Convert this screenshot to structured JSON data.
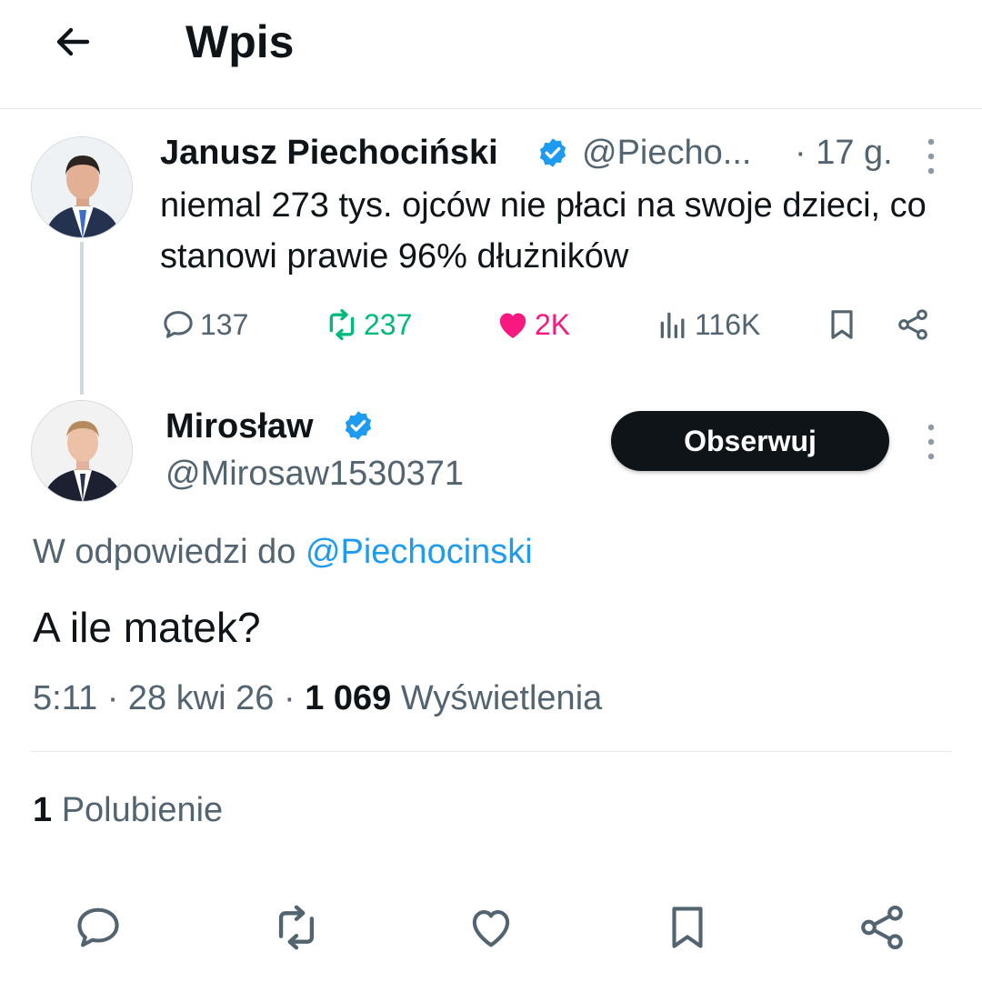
{
  "header": {
    "title": "Wpis",
    "back_icon": "arrow-left-icon"
  },
  "parent_post": {
    "author_name": "Janusz Piechociński",
    "handle": "@Piecho...",
    "time": "· 17 g.",
    "text": "niemal 273 tys. ojców nie płaci na swoje dzieci, co stanowi prawie 96% dłużników",
    "stats": {
      "replies": "137",
      "reposts": "237",
      "likes": "2K",
      "views": "116K"
    }
  },
  "reply_post": {
    "author_name": "Mirosław",
    "handle": "@Mirosaw1530371",
    "follow_label": "Obserwuj",
    "reply_prefix": "W odpowiedzi do ",
    "reply_mention": "@Piechocinski",
    "text": "A ile matek?",
    "time": "5:11 · 28 kwi 26 · ",
    "views_count": "1 069",
    "views_label": " Wyświetlenia"
  },
  "engagement": {
    "likes_count": "1",
    "likes_label": " Polubienie"
  },
  "colors": {
    "text": "#0f1419",
    "secondary": "#536471",
    "verified": "#1d9bf0",
    "repost": "#00ba7c",
    "like": "#f91880",
    "follow_bg": "#0f1419",
    "divider": "#e6e9eb"
  }
}
